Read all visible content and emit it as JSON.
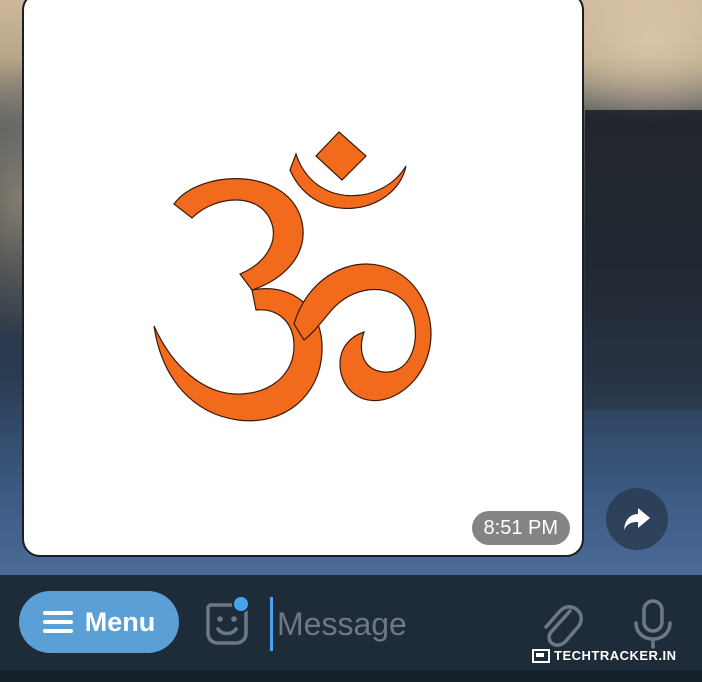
{
  "message": {
    "image_alt": "Om symbol",
    "timestamp": "8:51 PM"
  },
  "input_bar": {
    "menu_label": "Menu",
    "message_placeholder": "Message"
  },
  "watermark": {
    "text": "TECHTRACKER.IN"
  },
  "colors": {
    "om_orange": "#f26b1d",
    "menu_button_bg": "#5a9fd6",
    "accent_blue": "#4aa3f0",
    "input_bar_bg": "#1e2c3a",
    "icon_gray": "#6d7883"
  },
  "icons": {
    "menu": "hamburger-icon",
    "sticker": "sticker-icon",
    "attach": "paperclip-icon",
    "mic": "microphone-icon",
    "forward": "forward-arrow-icon"
  }
}
